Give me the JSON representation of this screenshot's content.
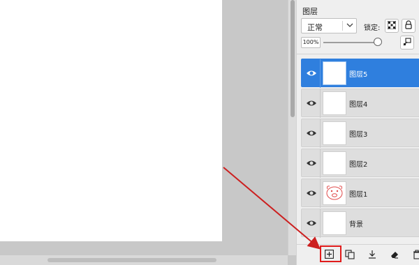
{
  "panel": {
    "title": "图层",
    "blend_mode": "正常",
    "lock_label": "锁定:",
    "opacity": "100%"
  },
  "layers": [
    {
      "name": "图层5",
      "selected": true
    },
    {
      "name": "图层4",
      "selected": false
    },
    {
      "name": "图层3",
      "selected": false
    },
    {
      "name": "图层2",
      "selected": false
    },
    {
      "name": "图层1",
      "selected": false
    },
    {
      "name": "背景",
      "selected": false
    }
  ],
  "icons": {
    "visibility": "eye-icon",
    "lock_alpha": "checker-icon",
    "lock_all": "lock-icon",
    "new_layer": "add-layer-icon",
    "duplicate": "duplicate-icon",
    "merge_down": "merge-down-icon",
    "clear": "eraser-icon",
    "delete": "trash-icon"
  },
  "colors": {
    "selected_layer": "#2f7fde",
    "highlight": "#e01b1b",
    "arrow": "#cc1f1f"
  }
}
